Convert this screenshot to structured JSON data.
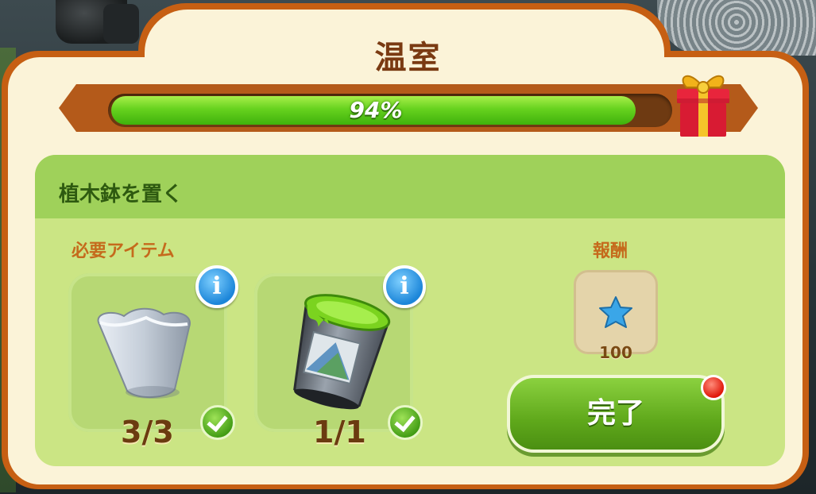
{
  "dialog": {
    "title": "温室",
    "progress": {
      "percent": 94,
      "label": "94%"
    }
  },
  "quest": {
    "title": "植木鉢を置く",
    "required_label": "必要アイテム",
    "reward_label": "報酬",
    "items": [
      {
        "icon": "flower-pot-icon",
        "count": "3/3",
        "complete": true
      },
      {
        "icon": "paint-bucket-icon",
        "count": "1/1",
        "complete": true
      }
    ],
    "reward": {
      "icon": "blue-star-icon",
      "amount": "100"
    },
    "complete_button": "完了"
  },
  "colors": {
    "frame": "#c65f13",
    "panel": "#fbf3d8",
    "quest_bg": "#cbe584",
    "progress_fill": "#66d21e",
    "button": "#5fa81b"
  }
}
